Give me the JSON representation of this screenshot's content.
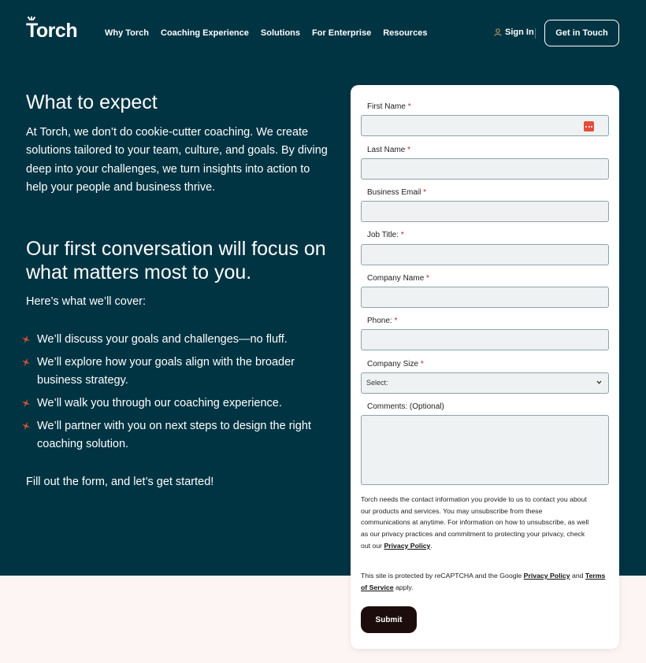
{
  "header": {
    "logo": "Torch",
    "nav": [
      "Why Torch",
      "Coaching Experience",
      "Solutions",
      "For Enterprise",
      "Resources"
    ],
    "sign_in": "Sign In",
    "get_in_touch": "Get in Touch"
  },
  "intro": {
    "title": "What to expect",
    "body": "At Torch, we don’t do cookie-cutter coaching. We create solutions tailored to your team, culture, and goals. By diving deep into your challenges, we turn insights into action to help your people and business thrive."
  },
  "conversation": {
    "title": "Our first conversation will focus on what matters most to you.",
    "cover_label": "Here’s what we’ll cover:",
    "bullets": [
      "We’ll discuss your goals and challenges—no fluff.",
      "We’ll explore how your goals align with the broader business strategy.",
      "We’ll walk you through our coaching experience.",
      "We’ll partner with you on next steps to design the right coaching solution."
    ],
    "closing": "Fill out the form, and let’s get started!"
  },
  "form": {
    "fields": [
      {
        "label": "First Name",
        "required": "*"
      },
      {
        "label": "Last Name",
        "required": "*"
      },
      {
        "label": "Business Email",
        "required": "*"
      },
      {
        "label": "Job Title:",
        "required": "*"
      },
      {
        "label": "Company Name",
        "required": "*"
      },
      {
        "label": "Phone:",
        "required": "*"
      }
    ],
    "company_size": {
      "label": "Company Size",
      "required": "*",
      "selected": "Select:"
    },
    "comments": {
      "label": "Comments: (Optional)"
    },
    "notice": {
      "text": "Torch needs the contact information you provide to us to contact you about our products and services. You may unsubscribe from these communications at anytime. For information on how to unsubscribe, as well as our privacy practices and commitment to protecting your privacy, check out our ",
      "link": "Privacy Policy",
      "end": "."
    },
    "recaptcha": {
      "prefix": "This site is protected by reCAPTCHA and the Google ",
      "privacy_link": "Privacy Policy",
      "and": " and ",
      "terms_link": "Terms of Service",
      "suffix": " apply."
    },
    "submit": "Submit"
  },
  "colors": {
    "hero_bg": "#003443",
    "accent_star": "#e4572e",
    "required": "#c0182b",
    "submit_bg": "#1c0d0c",
    "page_bg": "#fdf5f3"
  },
  "icons": {
    "sign_in": "user-icon",
    "bullet": "spark-star-icon",
    "password_manager": "password-manager-icon",
    "select": "chevron-down-icon"
  }
}
